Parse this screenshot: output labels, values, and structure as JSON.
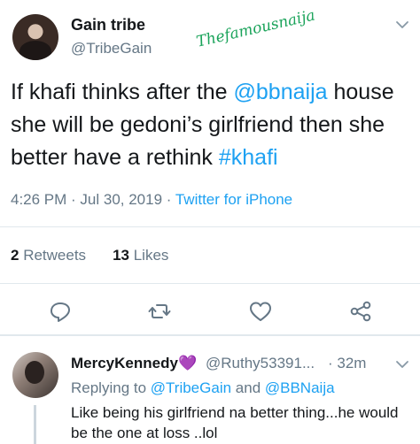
{
  "tweet": {
    "author_name": "Gain tribe",
    "author_handle": "@TribeGain",
    "watermark": "Thefamousnaija",
    "text_before": "If khafi thinks after the ",
    "mention": "@bbnaija",
    "text_middle": " house she will be gedoni’s girlfriend then she better have a rethink ",
    "hashtag": "#khafi",
    "time_date": "4:26 PM · Jul 30, 2019 · ",
    "source": "Twitter for iPhone",
    "retweets_count": "2",
    "retweets_label": " Retweets",
    "likes_count": "13",
    "likes_label": " Likes"
  },
  "actions": {
    "reply_icon": "reply-icon",
    "retweet_icon": "retweet-icon",
    "like_icon": "heart-icon",
    "share_icon": "share-icon"
  },
  "reply": {
    "author_name": "MercyKennedy",
    "emoji": "💜",
    "author_handle": "@Ruthy53391...",
    "time": "· 32m",
    "replying_prefix": "Replying to ",
    "replying_user1": "@TribeGain",
    "replying_and": " and ",
    "replying_user2": "@BBNaija",
    "text": "Like being his girlfriend na better thing...he would be the one at loss ..lol"
  },
  "colors": {
    "link": "#1da1f2",
    "secondary_text": "#657786",
    "primary_text": "#14171a",
    "watermark": "#1aa35a",
    "divider": "#e1e8ed"
  }
}
